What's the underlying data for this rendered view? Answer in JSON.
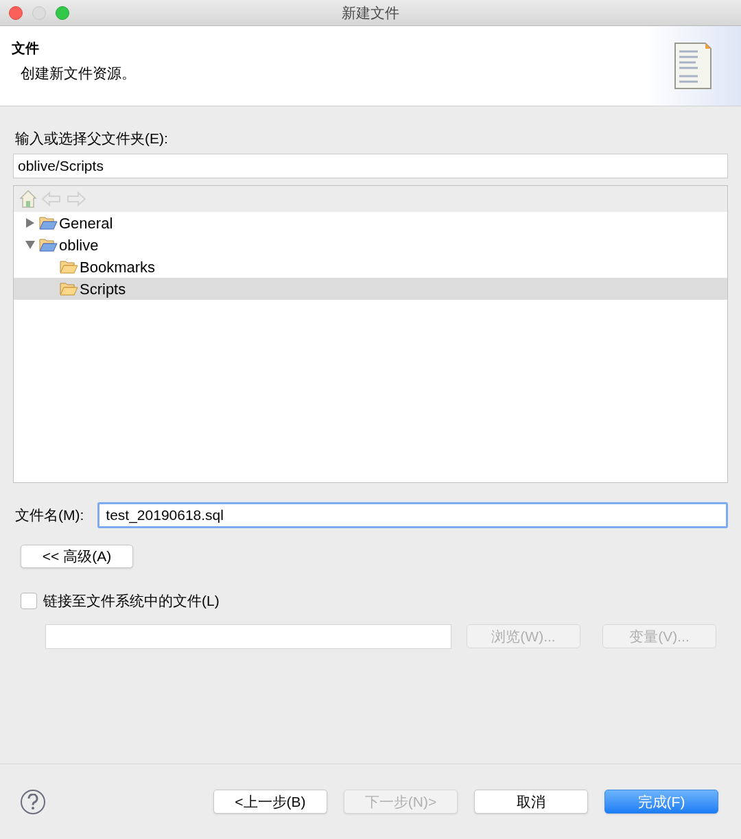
{
  "window": {
    "title": "新建文件"
  },
  "header": {
    "title": "文件",
    "description": "创建新文件资源。"
  },
  "parent_folder": {
    "label": "输入或选择父文件夹(E):",
    "value": "oblive/Scripts"
  },
  "tree": [
    {
      "label": "General",
      "expanded": false,
      "selected": false
    },
    {
      "label": "oblive",
      "expanded": true,
      "selected": false,
      "children": [
        {
          "label": "Bookmarks",
          "selected": false
        },
        {
          "label": "Scripts",
          "selected": true
        }
      ]
    }
  ],
  "file_name": {
    "label": "文件名(M):",
    "value": "test_20190618.sql",
    "focused": true
  },
  "advanced_button": {
    "label": "<< 高级(A)"
  },
  "link": {
    "label": "链接至文件系统中的文件(L)",
    "checked": false,
    "browse": {
      "label": "浏览(W)...",
      "disabled": true
    },
    "variables": {
      "label": "变量(V)...",
      "disabled": true
    }
  },
  "buttons": [
    {
      "label": "<上一步(B)",
      "kind": "normal",
      "disabled": false
    },
    {
      "label": "下一步(N)>",
      "kind": "normal",
      "disabled": true
    },
    {
      "label": "取消",
      "kind": "normal",
      "disabled": false
    },
    {
      "label": "完成(F)",
      "kind": "default",
      "disabled": false
    }
  ]
}
